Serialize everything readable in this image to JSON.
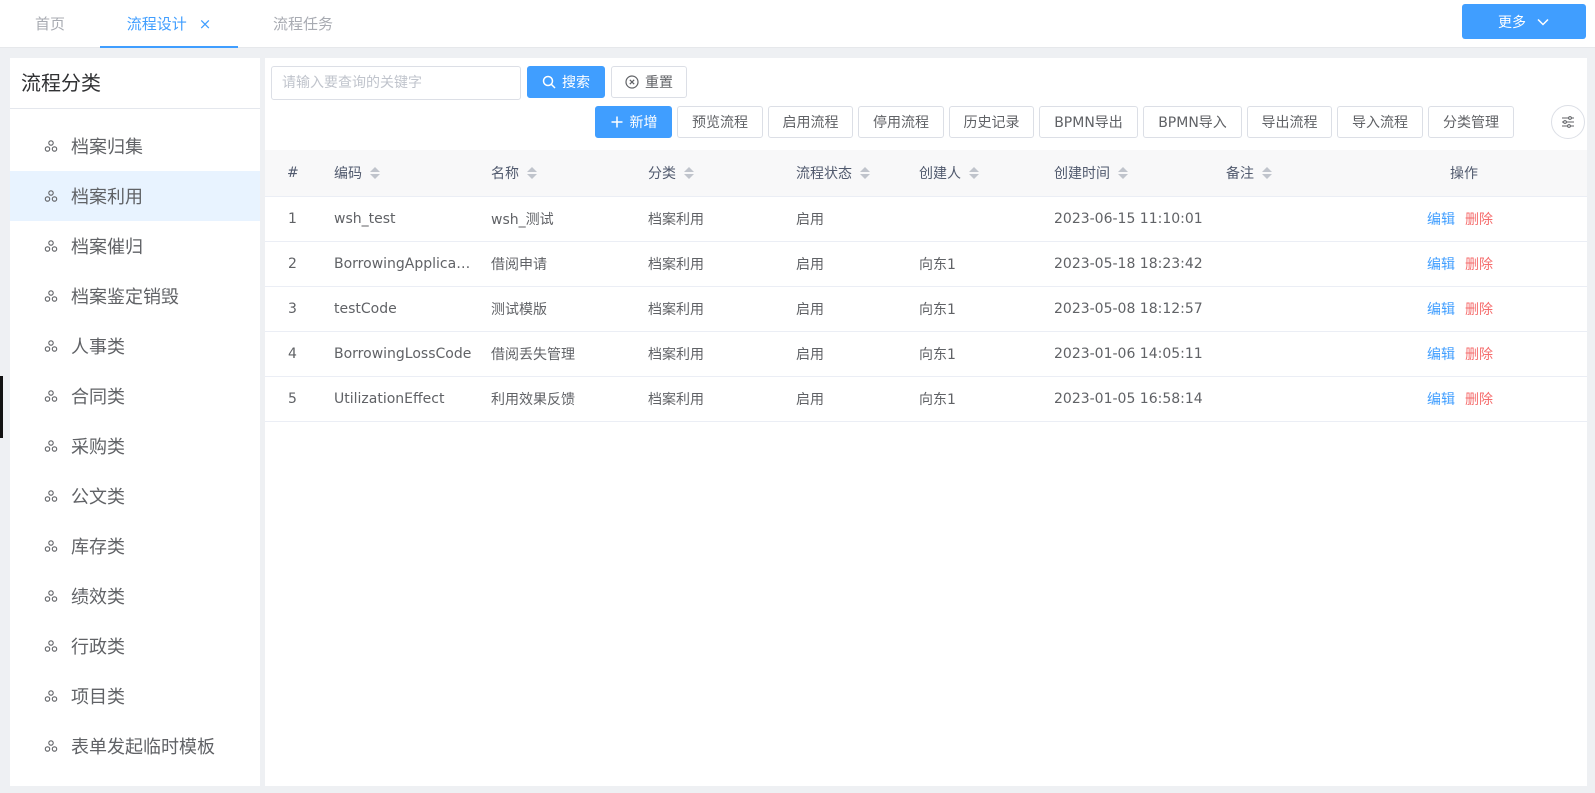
{
  "tabs": [
    {
      "label": "首页",
      "active": false
    },
    {
      "label": "流程设计",
      "active": true,
      "close": "×"
    },
    {
      "label": "流程任务",
      "active": false
    }
  ],
  "more_button": "更多",
  "sidebar": {
    "title": "流程分类",
    "items": [
      "档案归集",
      "档案利用",
      "档案催归",
      "档案鉴定销毁",
      "人事类",
      "合同类",
      "采购类",
      "公文类",
      "库存类",
      "绩效类",
      "行政类",
      "项目类",
      "表单发起临时模板"
    ],
    "active_index": 1
  },
  "search": {
    "placeholder": "请输入要查询的关键字",
    "search_label": "搜索",
    "reset_label": "重置"
  },
  "toolbar": {
    "add": "新增",
    "preview": "预览流程",
    "enable": "启用流程",
    "disable": "停用流程",
    "history": "历史记录",
    "bpmn_export": "BPMN导出",
    "bpmn_import": "BPMN导入",
    "export": "导出流程",
    "import": "导入流程",
    "category": "分类管理"
  },
  "table": {
    "headers": {
      "index": "#",
      "code": "编码",
      "name": "名称",
      "category": "分类",
      "status": "流程状态",
      "creator": "创建人",
      "created": "创建时间",
      "remark": "备注",
      "actions": "操作"
    },
    "rows": [
      {
        "index": "1",
        "code": "wsh_test",
        "name": "wsh_测试",
        "category": "档案利用",
        "status": "启用",
        "creator": "",
        "created": "2023-06-15 11:10:01",
        "remark": ""
      },
      {
        "index": "2",
        "code": "BorrowingApplicat...",
        "name": "借阅申请",
        "category": "档案利用",
        "status": "启用",
        "creator": "向东1",
        "created": "2023-05-18 18:23:42",
        "remark": ""
      },
      {
        "index": "3",
        "code": "testCode",
        "name": "测试模版",
        "category": "档案利用",
        "status": "启用",
        "creator": "向东1",
        "created": "2023-05-08 18:12:57",
        "remark": ""
      },
      {
        "index": "4",
        "code": "BorrowingLossCode",
        "name": "借阅丢失管理",
        "category": "档案利用",
        "status": "启用",
        "creator": "向东1",
        "created": "2023-01-06 14:05:11",
        "remark": ""
      },
      {
        "index": "5",
        "code": "UtilizationEffect",
        "name": "利用效果反馈",
        "category": "档案利用",
        "status": "启用",
        "creator": "向东1",
        "created": "2023-01-05 16:58:14",
        "remark": ""
      }
    ],
    "edit_label": "编辑",
    "delete_label": "删除"
  },
  "colors": {
    "primary": "#409eff",
    "danger": "#f56c6c",
    "active_bg": "#e8f3ff"
  }
}
